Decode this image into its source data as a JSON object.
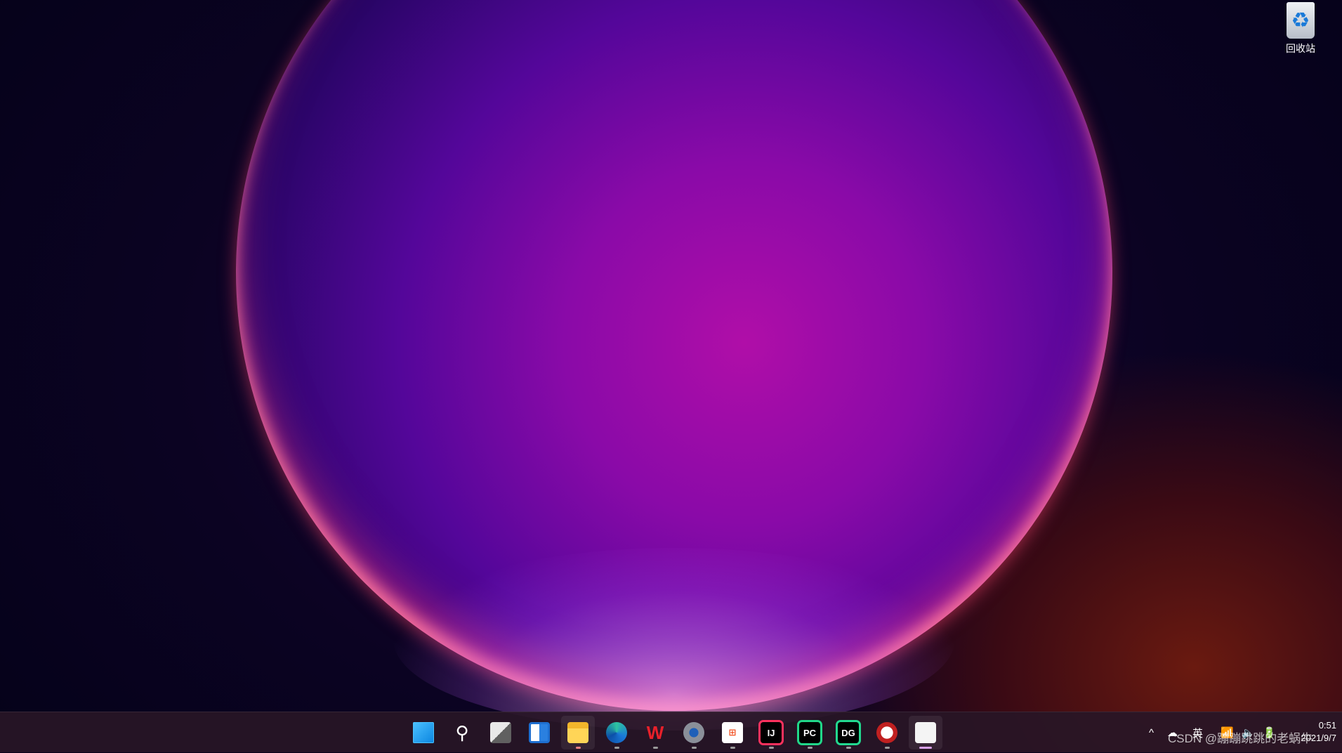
{
  "desktop": {
    "icons": [
      {
        "label": "回收站",
        "icon": "recycle-bin-icon"
      }
    ]
  },
  "taskbar": {
    "apps": [
      {
        "name": "start",
        "icon": "windows-start-icon",
        "active": false,
        "running": false
      },
      {
        "name": "search",
        "icon": "search-icon",
        "active": false,
        "running": false
      },
      {
        "name": "task-view",
        "icon": "task-view-icon",
        "active": false,
        "running": false
      },
      {
        "name": "widgets",
        "icon": "widgets-icon",
        "active": false,
        "running": false
      },
      {
        "name": "file-explorer",
        "icon": "folder-icon",
        "active": true,
        "running": true
      },
      {
        "name": "edge",
        "icon": "edge-icon",
        "active": false,
        "running": true
      },
      {
        "name": "wps",
        "icon": "wps-icon",
        "active": false,
        "running": true
      },
      {
        "name": "settings",
        "icon": "gear-icon",
        "active": false,
        "running": true
      },
      {
        "name": "store",
        "icon": "store-icon",
        "active": false,
        "running": true
      },
      {
        "name": "intellij",
        "icon": "intellij-icon",
        "label": "IJ",
        "active": false,
        "running": true
      },
      {
        "name": "pycharm",
        "icon": "pycharm-icon",
        "label": "PC",
        "active": false,
        "running": true
      },
      {
        "name": "datagrip",
        "icon": "datagrip-icon",
        "label": "DG",
        "active": false,
        "running": true
      },
      {
        "name": "app",
        "icon": "app-icon",
        "active": false,
        "running": true
      },
      {
        "name": "snipping-tool",
        "icon": "snipping-tool-icon",
        "active": true,
        "running": true
      }
    ],
    "tray": {
      "chevron": "^",
      "ime": "英",
      "time": "0:51",
      "date": "2021/9/7"
    }
  },
  "watermark": "CSDN @蹦蹦跳跳的老蜗牛",
  "colors": {
    "accent": "#d8a0e8",
    "taskbar": "#281626"
  }
}
